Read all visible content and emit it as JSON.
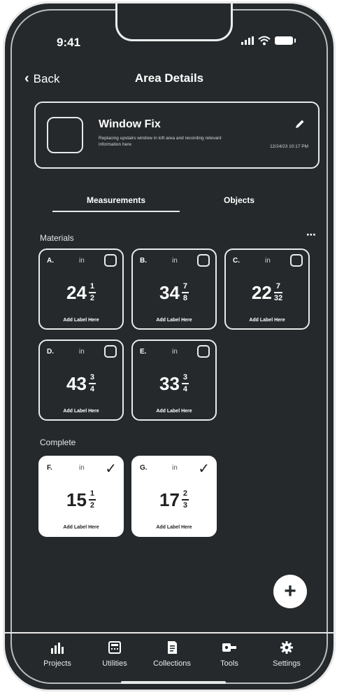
{
  "status": {
    "time": "9:41"
  },
  "nav": {
    "back_label": "Back",
    "title": "Area Details"
  },
  "project": {
    "title": "Window Fix",
    "description": "Replacing upstairs window in loft area and recording relevant information here",
    "date": "12/24/23 10:17 PM"
  },
  "tabs": {
    "measurements": "Measurements",
    "objects": "Objects"
  },
  "sections": {
    "materials": "Materials",
    "complete": "Complete"
  },
  "more_icon": "⋯",
  "tiles": [
    {
      "letter": "A.",
      "unit": "in",
      "whole": "24",
      "num": "1",
      "den": "2",
      "label": "Add Label Here"
    },
    {
      "letter": "B.",
      "unit": "in",
      "whole": "34",
      "num": "7",
      "den": "8",
      "label": "Add Label Here"
    },
    {
      "letter": "C.",
      "unit": "in",
      "whole": "22",
      "num": "7",
      "den": "32",
      "label": "Add Label Here"
    },
    {
      "letter": "D.",
      "unit": "in",
      "whole": "43",
      "num": "3",
      "den": "4",
      "label": "Add Label Here"
    },
    {
      "letter": "E.",
      "unit": "in",
      "whole": "33",
      "num": "3",
      "den": "4",
      "label": "Add Label Here"
    },
    {
      "letter": "F.",
      "unit": "in",
      "whole": "15",
      "num": "1",
      "den": "2",
      "label": "Add Label Here"
    },
    {
      "letter": "G.",
      "unit": "in",
      "whole": "17",
      "num": "2",
      "den": "3",
      "label": "Add Label Here"
    }
  ],
  "fab_label": "+",
  "tabbar": [
    {
      "label": "Projects",
      "icon": "bar-chart-icon"
    },
    {
      "label": "Utilities",
      "icon": "calculator-icon"
    },
    {
      "label": "Collections",
      "icon": "document-icon"
    },
    {
      "label": "Tools",
      "icon": "tape-measure-icon"
    },
    {
      "label": "Settings",
      "icon": "gear-icon"
    }
  ]
}
